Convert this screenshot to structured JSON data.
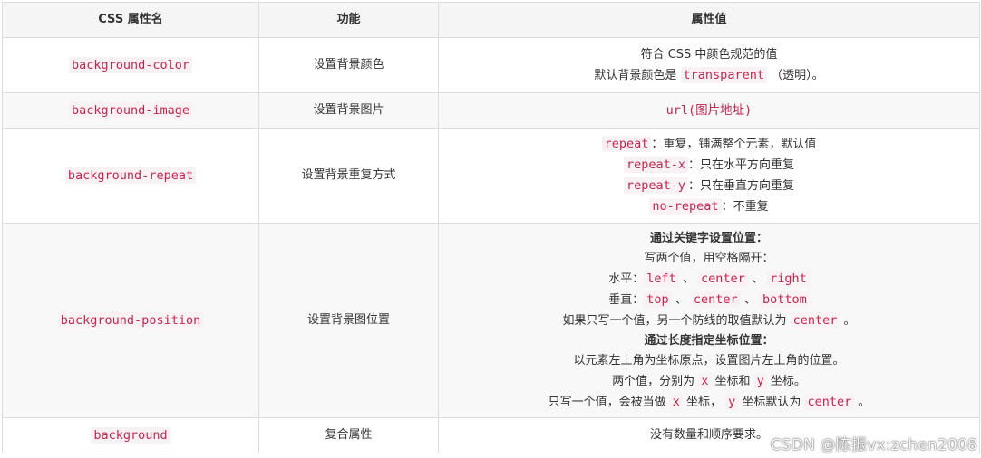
{
  "table": {
    "headers": [
      "CSS 属性名",
      "功能",
      "属性值"
    ],
    "rows": [
      {
        "property": "background-color",
        "function": "设置背景颜色",
        "value_lines": [
          [
            "符合 CSS 中颜色规范的值"
          ],
          [
            "默认背景颜色是 ",
            "transparent",
            " （透明）。"
          ]
        ]
      },
      {
        "property": "background-image",
        "function": "设置背景图片",
        "value_code": "url(图片地址)"
      },
      {
        "property": "background-repeat",
        "function": "设置背景重复方式",
        "value_lines": [
          [
            "repeat",
            "：重复，铺满整个元素，默认值"
          ],
          [
            "repeat-x",
            "：只在水平方向重复"
          ],
          [
            "repeat-y",
            "：只在垂直方向重复"
          ],
          [
            "no-repeat",
            "：不重复"
          ]
        ]
      },
      {
        "property": "background-position",
        "function": "设置背景图位置",
        "keyword_heading": "通过关键字设置位置：",
        "keyword_intro": "写两个值，用空格隔开：",
        "horizontal": [
          "水平：",
          "left",
          "、",
          "center",
          "、",
          "right"
        ],
        "vertical": [
          "垂直：",
          "top",
          "、",
          "center",
          "、",
          "bottom"
        ],
        "single_value": [
          "如果只写一个值，另一个防线的取值默认为 ",
          "center",
          " 。"
        ],
        "length_heading": "通过长度指定坐标位置：",
        "length_intro": "以元素左上角为坐标原点，设置图片左上角的位置。",
        "two_values": [
          "两个值，分别为 ",
          "x",
          " 坐标和 ",
          "y",
          " 坐标。"
        ],
        "one_value": [
          "只写一个值，会被当做 ",
          "x",
          " 坐标， ",
          "y",
          " 坐标默认为 ",
          "center",
          " 。"
        ]
      },
      {
        "property": "background",
        "function": "复合属性",
        "value_text": "没有数量和顺序要求。"
      }
    ]
  },
  "watermark": "CSDN @陈振vx:zchen2008"
}
